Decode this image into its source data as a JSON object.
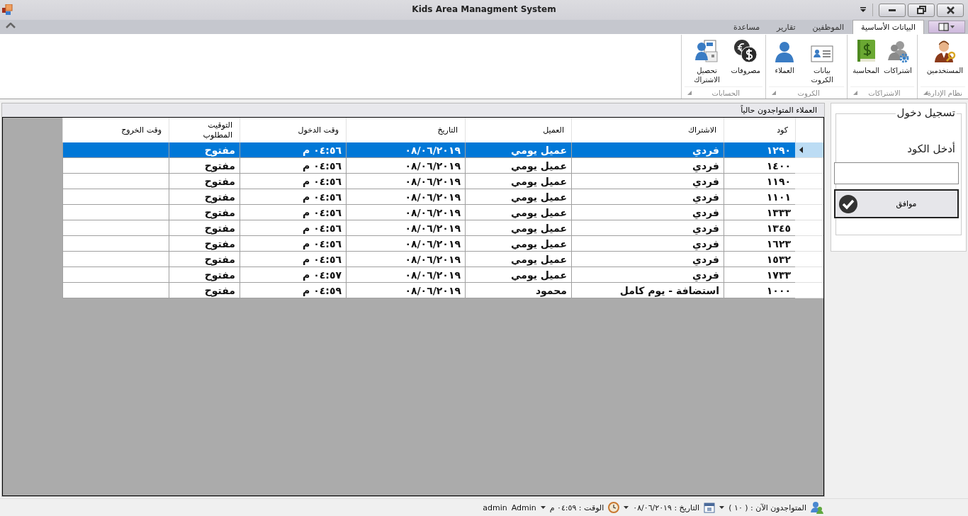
{
  "window": {
    "title": "Kids Area Managment System"
  },
  "ribbon": {
    "tabs": [
      {
        "label": "البيانات الأساسية",
        "selected": true
      },
      {
        "label": "الموظفين",
        "selected": false
      },
      {
        "label": "تقارير",
        "selected": false
      },
      {
        "label": "مساعدة",
        "selected": false
      }
    ],
    "groups": [
      {
        "label": "نظام الإدارة",
        "buttons": [
          {
            "label": "المستخدمين",
            "kind": "user-key"
          }
        ]
      },
      {
        "label": "الاشتراكات",
        "buttons": [
          {
            "label": "اشتراكات",
            "kind": "users-gear"
          },
          {
            "label": "المحاسبة",
            "kind": "book"
          }
        ]
      },
      {
        "label": "الكروت",
        "buttons": [
          {
            "label": "بيانات الكروت",
            "kind": "card"
          },
          {
            "label": "العملاء",
            "kind": "person"
          }
        ]
      },
      {
        "label": "الحسابات",
        "buttons": [
          {
            "label": "مصروفات",
            "kind": "coins"
          },
          {
            "label": "تحصيل الاشتراك",
            "kind": "form"
          }
        ]
      }
    ]
  },
  "grid": {
    "caption": "العملاء المتواجدون حالياً",
    "columns": [
      "كود",
      "الاشتراك",
      "العميل",
      "التاريخ",
      "وقت الدخول",
      "التوقيت المطلوب",
      "وقت الخروج"
    ],
    "rows": [
      {
        "selected": true,
        "cells": [
          "١٢٩٠",
          "فردي",
          "عميل يومي",
          "٠٨/٠٦/٢٠١٩",
          "٠٤:٥٦ م",
          "مفتوح"
        ]
      },
      {
        "selected": false,
        "cells": [
          "١٤٠٠",
          "فردي",
          "عميل يومي",
          "٠٨/٠٦/٢٠١٩",
          "٠٤:٥٦ م",
          "مفتوح"
        ]
      },
      {
        "selected": false,
        "cells": [
          "١١٩٠",
          "فردي",
          "عميل يومي",
          "٠٨/٠٦/٢٠١٩",
          "٠٤:٥٦ م",
          "مفتوح"
        ]
      },
      {
        "selected": false,
        "cells": [
          "١١٠١",
          "فردي",
          "عميل يومي",
          "٠٨/٠٦/٢٠١٩",
          "٠٤:٥٦ م",
          "مفتوح"
        ]
      },
      {
        "selected": false,
        "cells": [
          "١٣٣٣",
          "فردي",
          "عميل يومي",
          "٠٨/٠٦/٢٠١٩",
          "٠٤:٥٦ م",
          "مفتوح"
        ]
      },
      {
        "selected": false,
        "cells": [
          "١٣٤٥",
          "فردي",
          "عميل يومي",
          "٠٨/٠٦/٢٠١٩",
          "٠٤:٥٦ م",
          "مفتوح"
        ]
      },
      {
        "selected": false,
        "cells": [
          "١٦٢٣",
          "فردي",
          "عميل يومي",
          "٠٨/٠٦/٢٠١٩",
          "٠٤:٥٦ م",
          "مفتوح"
        ]
      },
      {
        "selected": false,
        "cells": [
          "١٥٣٢",
          "فردي",
          "عميل يومي",
          "٠٨/٠٦/٢٠١٩",
          "٠٤:٥٦ م",
          "مفتوح"
        ]
      },
      {
        "selected": false,
        "cells": [
          "١٧٣٣",
          "فردي",
          "عميل يومي",
          "٠٨/٠٦/٢٠١٩",
          "٠٤:٥٧ م",
          "مفتوح"
        ]
      },
      {
        "selected": false,
        "cells": [
          "١٠٠٠",
          "استضافة - يوم كامل",
          "محمود",
          "٠٨/٠٦/٢٠١٩",
          "٠٤:٥٩ م",
          "مفتوح"
        ]
      }
    ]
  },
  "login": {
    "title": "تسجيل دخول",
    "label": "أدخل الكود",
    "button": "موافق"
  },
  "status_bar": {
    "present": "المتواجدون الآن : ( ١٠ )",
    "date": "التاريخ : ٠٨/٠٦/٢٠١٩",
    "time": "الوقت : ٠٤:٥٩ م",
    "role": "Admin",
    "user": "admin"
  }
}
